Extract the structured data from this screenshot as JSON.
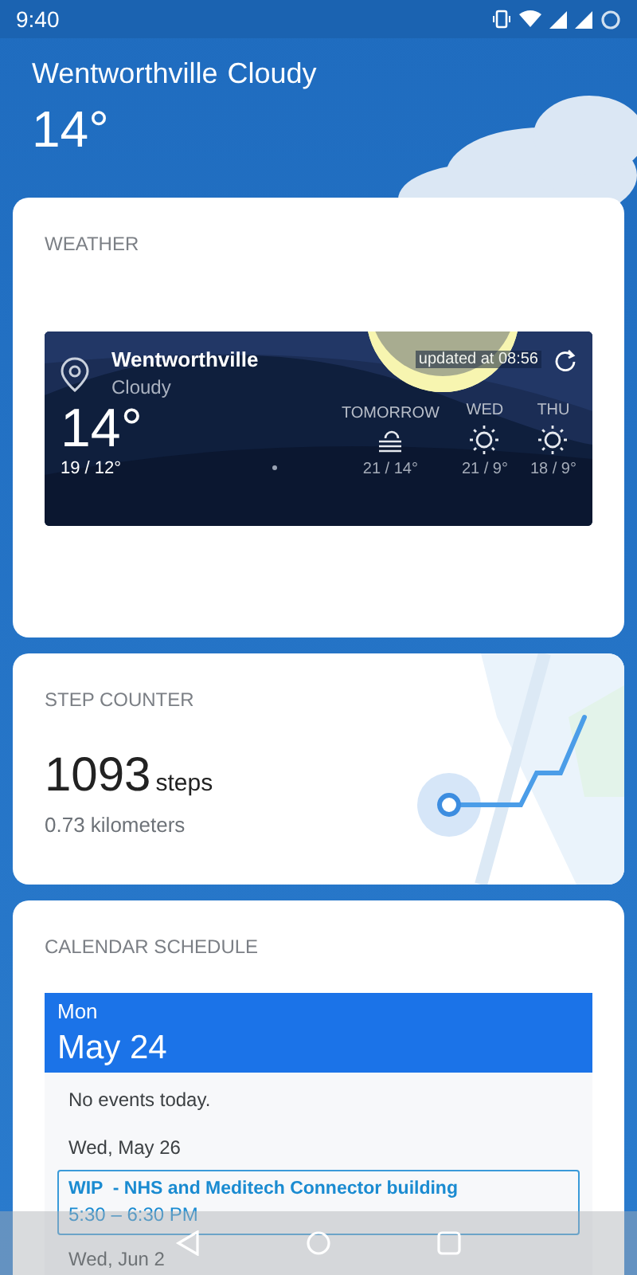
{
  "status_bar": {
    "time": "9:40"
  },
  "header": {
    "location": "Wentworthville",
    "condition": "Cloudy",
    "temperature": "14°"
  },
  "weather_card": {
    "title": "WEATHER",
    "widget": {
      "location": "Wentworthville",
      "condition": "Cloudy",
      "updated": "updated at 08:56",
      "temperature": "14°",
      "range": "19 / 12°",
      "forecast": [
        {
          "day": "TOMORROW",
          "kind": "fog",
          "range": "21 / 14°"
        },
        {
          "day": "WED",
          "kind": "sunny",
          "range": "21 / 9°"
        },
        {
          "day": "THU",
          "kind": "sunny",
          "range": "18 / 9°"
        }
      ]
    }
  },
  "step_card": {
    "title": "STEP COUNTER",
    "steps": "1093",
    "unit": "steps",
    "distance": "0.73 kilometers"
  },
  "calendar_card": {
    "title": "CALENDAR SCHEDULE",
    "weekday": "Mon",
    "date": "May 24",
    "items": [
      {
        "kind": "note",
        "text": "No events today."
      },
      {
        "kind": "date",
        "text": "Wed, May 26"
      },
      {
        "kind": "event",
        "title": "WIP  - NHS and Meditech Connector building",
        "time": "5:30 – 6:30 PM"
      },
      {
        "kind": "date",
        "text": "Wed, Jun 2"
      }
    ]
  }
}
